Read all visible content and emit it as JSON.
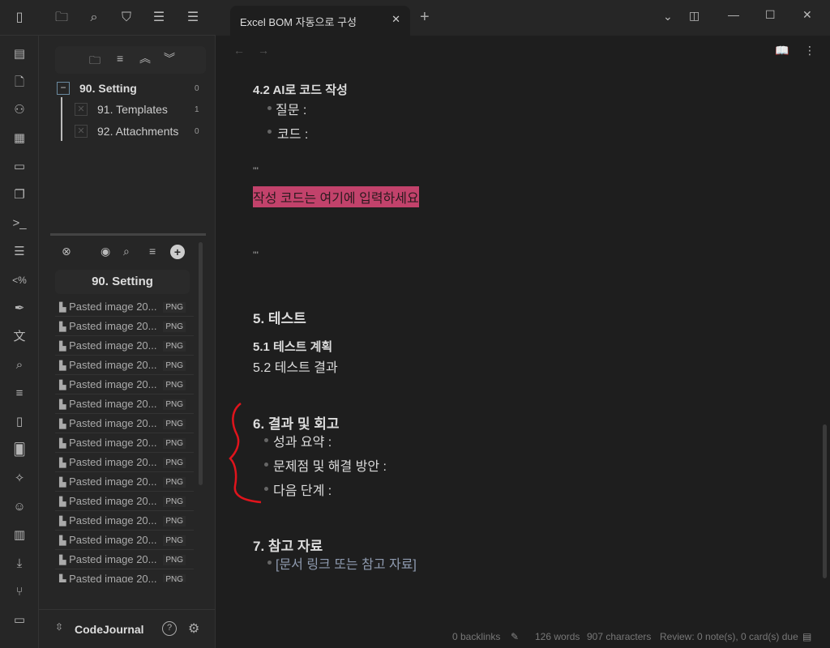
{
  "tab": {
    "title": "Excel BOM 자동으로 구성",
    "new_tab": "+"
  },
  "folders": [
    {
      "name": "90. Setting",
      "count": "0"
    },
    {
      "name": "91. Templates",
      "count": "1"
    },
    {
      "name": "92. Attachments",
      "count": "0"
    }
  ],
  "file_panel": {
    "title": "90. Setting",
    "files": [
      "Pasted image 20...",
      "Pasted image 20...",
      "Pasted image 20...",
      "Pasted image 20...",
      "Pasted image 20...",
      "Pasted image 20...",
      "Pasted image 20...",
      "Pasted image 20...",
      "Pasted image 20...",
      "Pasted image 20...",
      "Pasted image 20...",
      "Pasted image 20...",
      "Pasted image 20...",
      "Pasted image 20...",
      "Pasted image 20..."
    ],
    "ext": "PNG"
  },
  "vault": {
    "name": "CodeJournal"
  },
  "doc": {
    "h42": "4.2 AI로 코드 작성",
    "q": "질문 :",
    "code": "코드 :",
    "fence": "'''",
    "highlight": "작성 코드는 여기에 입력하세요",
    "fence2": "'''",
    "h5": "5. 테스트",
    "h51": "5.1 테스트 계획",
    "h52": "5.2 테스트 결과",
    "h6": "6. 결과 및 회고",
    "b61": "성과 요약 :",
    "b62": "문제점 및 해결 방안 :",
    "b63": "다음 단계 :",
    "h7": "7. 참고 자료",
    "b71": "[문서 링크 또는 참고 자료]"
  },
  "status": {
    "backlinks": "0 backlinks",
    "words": "126 words",
    "chars": "907 characters",
    "review": "Review: 0 note(s), 0 card(s) due"
  },
  "colors": {
    "highlight": "#c2426b",
    "annotation": "#e0141c"
  }
}
